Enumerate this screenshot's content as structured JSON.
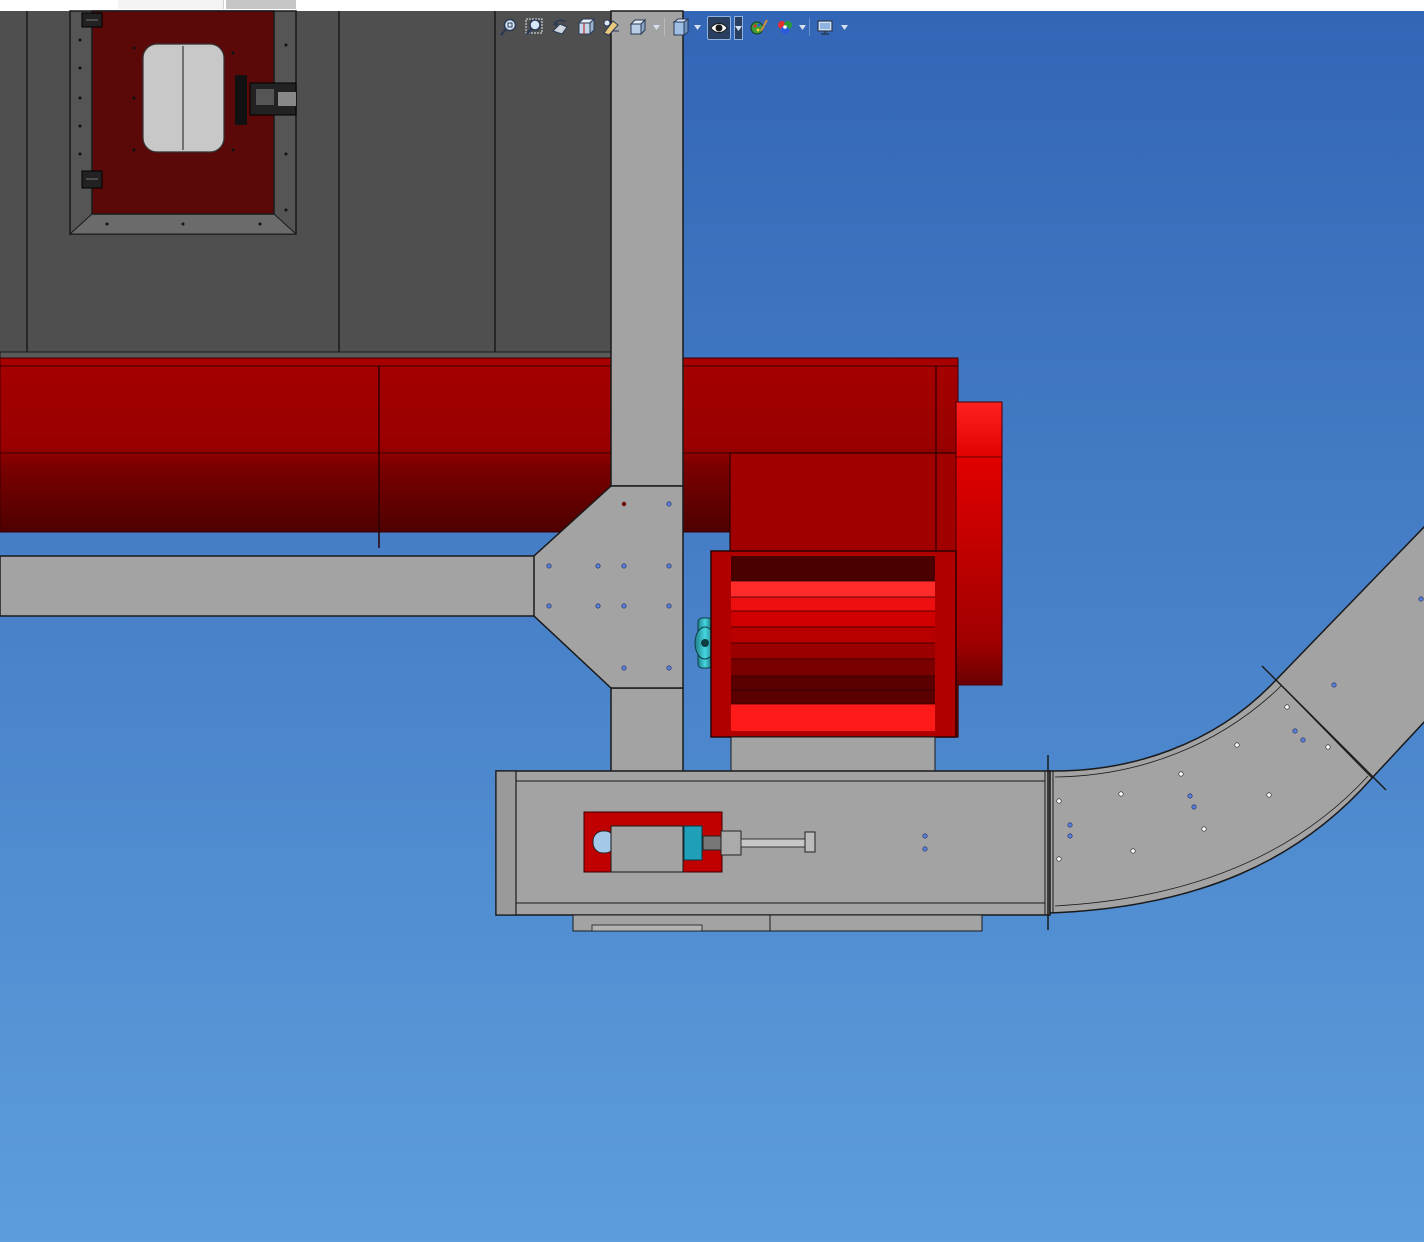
{
  "window": {
    "topbar_tabs": [
      "tab-1",
      "tab-2"
    ]
  },
  "hud_toolbar": {
    "buttons": [
      {
        "icon": "zoom-to-fit-icon"
      },
      {
        "icon": "zoom-to-area-icon"
      },
      {
        "icon": "previous-view-icon"
      },
      {
        "icon": "section-view-icon"
      },
      {
        "icon": "dynamic-annotation-icon"
      },
      {
        "icon": "view-orientation-icon"
      },
      {
        "icon": "display-style-icon"
      },
      {
        "icon": "hide-show-items-icon"
      },
      {
        "icon": "edit-appearance-icon"
      },
      {
        "icon": "apply-scene-icon"
      },
      {
        "icon": "view-settings-icon"
      }
    ],
    "active_button": "hide-show-items-icon"
  },
  "scene": {
    "background_top": "#3366b6",
    "background_bottom": "#5d9ddc",
    "colors": {
      "panel_dark": "#4f4f4f",
      "frame_gray": "#a3a3a3",
      "duct_red": "#a00000",
      "duct_dark_red": "#5a0000",
      "bright_red": "#ff1a1a",
      "door_red": "#5a0808",
      "window_gray": "#c8c8c8",
      "bearing_cyan": "#2fb4c0"
    }
  }
}
